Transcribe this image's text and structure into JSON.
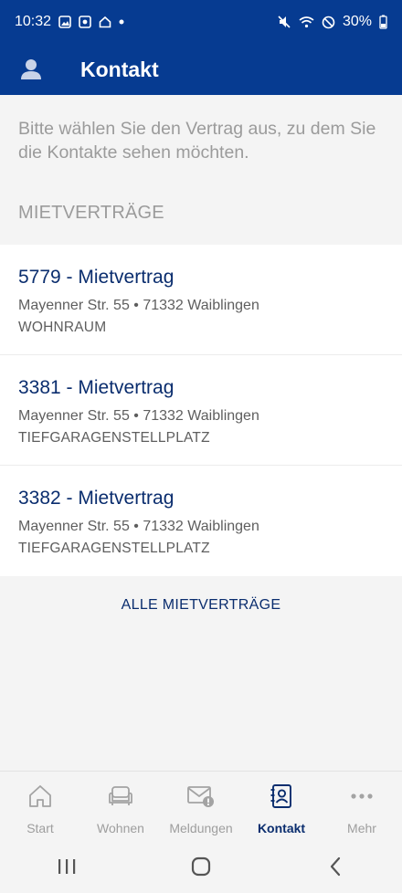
{
  "status_bar": {
    "time": "10:32",
    "battery": "30%"
  },
  "header": {
    "title": "Kontakt"
  },
  "intro_text": "Bitte wählen Sie den Vertrag aus, zu dem Sie die Kontakte sehen möchten.",
  "section_title": "MIETVERTRÄGE",
  "contracts": [
    {
      "title": "5779 - Mietvertrag",
      "address": "Mayenner Str. 55 • 71332 Waiblingen",
      "type": "WOHNRAUM"
    },
    {
      "title": "3381 - Mietvertrag",
      "address": "Mayenner Str. 55 • 71332 Waiblingen",
      "type": "TIEFGARAGENSTELLPLATZ"
    },
    {
      "title": "3382 - Mietvertrag",
      "address": "Mayenner Str. 55 • 71332 Waiblingen",
      "type": "TIEFGARAGENSTELLPLATZ"
    }
  ],
  "all_contracts_label": "ALLE MIETVERTRÄGE",
  "bottom_nav": [
    {
      "label": "Start",
      "icon": "home-icon"
    },
    {
      "label": "Wohnen",
      "icon": "sofa-icon"
    },
    {
      "label": "Meldungen",
      "icon": "mail-alert-icon"
    },
    {
      "label": "Kontakt",
      "icon": "contact-book-icon",
      "active": true
    },
    {
      "label": "Mehr",
      "icon": "more-dots-icon"
    }
  ],
  "colors": {
    "primary": "#063b91",
    "link": "#0a2d6e",
    "muted": "#9b9b9b"
  }
}
